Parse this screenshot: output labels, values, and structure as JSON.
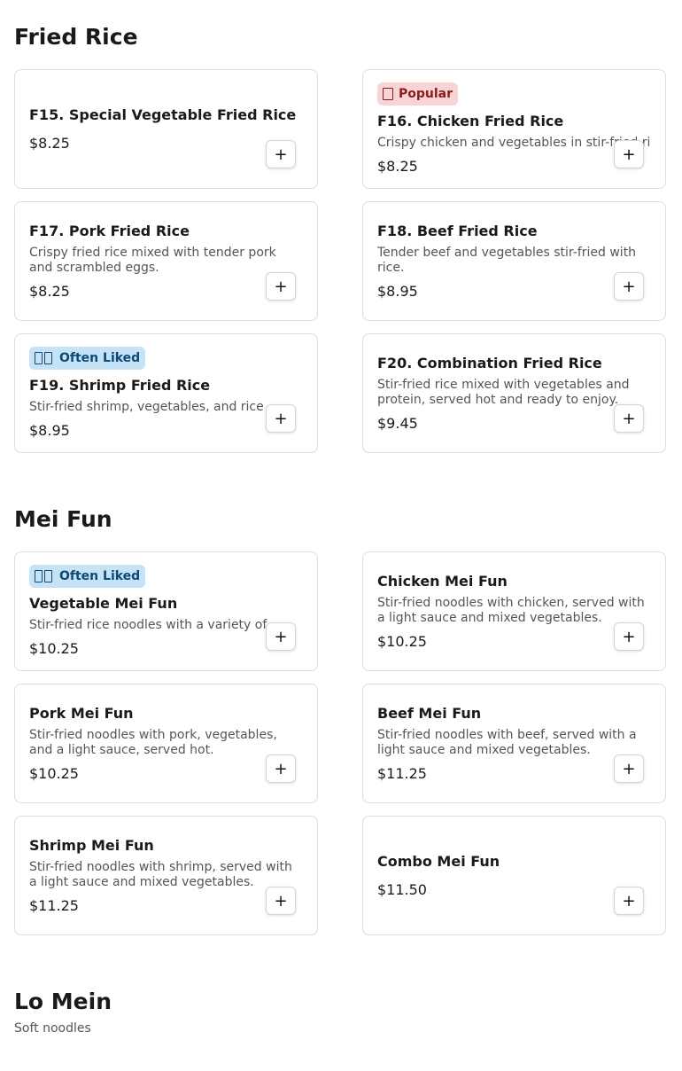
{
  "sections": [
    {
      "title": "Fried Rice",
      "items": [
        {
          "name": "F15. Special Vegetable Fried Rice",
          "desc": "",
          "price": "$8.25",
          "badge": null
        },
        {
          "name": "F16. Chicken Fried Rice",
          "desc": "Crispy chicken and vegetables in stir-fried rice.",
          "price": "$8.25",
          "badge": {
            "type": "popular",
            "label": "Popular",
            "icon": "flame-icon"
          }
        },
        {
          "name": "F17. Pork Fried Rice",
          "desc": "Crispy fried rice mixed with tender pork and scrambled eggs.",
          "price": "$8.25",
          "badge": null
        },
        {
          "name": "F18. Beef Fried Rice",
          "desc": "Tender beef and vegetables stir-fried with rice.",
          "price": "$8.95",
          "badge": null
        },
        {
          "name": "F19. Shrimp Fried Rice",
          "desc": "Stir-fried shrimp, vegetables, and rice",
          "price": "$8.95",
          "badge": {
            "type": "liked",
            "label": "Often Liked",
            "icon": "thumbs-up-icon"
          }
        },
        {
          "name": "F20. Combination Fried Rice",
          "desc": "Stir-fried rice mixed with vegetables and protein, served hot and ready to enjoy.",
          "price": "$9.45",
          "badge": null
        }
      ]
    },
    {
      "title": "Mei Fun",
      "items": [
        {
          "name": "Vegetable Mei Fun",
          "desc": "Stir-fried rice noodles with a variety of",
          "price": "$10.25",
          "badge": {
            "type": "liked",
            "label": "Often Liked",
            "icon": "thumbs-up-icon"
          }
        },
        {
          "name": "Chicken Mei Fun",
          "desc": "Stir-fried noodles with chicken, served with a light sauce and mixed vegetables.",
          "price": "$10.25",
          "badge": null
        },
        {
          "name": "Pork Mei Fun",
          "desc": "Stir-fried noodles with pork, vegetables, and a light sauce, served hot.",
          "price": "$10.25",
          "badge": null
        },
        {
          "name": "Beef Mei Fun",
          "desc": "Stir-fried noodles with beef, served with a light sauce and mixed vegetables.",
          "price": "$11.25",
          "badge": null
        },
        {
          "name": "Shrimp Mei Fun",
          "desc": "Stir-fried noodles with shrimp, served with a light sauce and mixed vegetables.",
          "price": "$11.25",
          "badge": null
        },
        {
          "name": "Combo Mei Fun",
          "desc": "",
          "price": "$11.50",
          "badge": null
        }
      ]
    },
    {
      "title": "Lo Mein",
      "subtitle": "Soft noodles",
      "items": []
    }
  ],
  "add_button_label": "+"
}
